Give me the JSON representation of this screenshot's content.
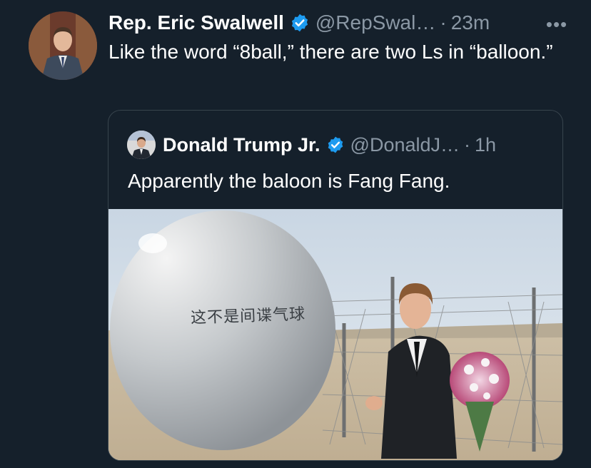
{
  "tweet": {
    "author_name": "Rep. Eric Swalwell",
    "handle": "@RepSwal…",
    "separator": "·",
    "time": "23m",
    "more_label": "•••",
    "text": "Like the word “8ball,” there are two Ls in “balloon.”",
    "avatar_icon": "profile-photo",
    "verified_icon": "verified-badge-icon"
  },
  "quoted_tweet": {
    "author_name": "Donald Trump Jr.",
    "handle": "@DonaldJ…",
    "separator": "·",
    "time": "1h",
    "text": "Apparently the baloon is Fang Fang.",
    "avatar_icon": "profile-photo",
    "media": {
      "balloon_text": "这不是间谍气球"
    }
  },
  "colors": {
    "background": "#15202b",
    "text_primary": "#ffffff",
    "text_secondary": "#8b98a5",
    "verified": "#1d9bf0",
    "border": "#38444d"
  }
}
